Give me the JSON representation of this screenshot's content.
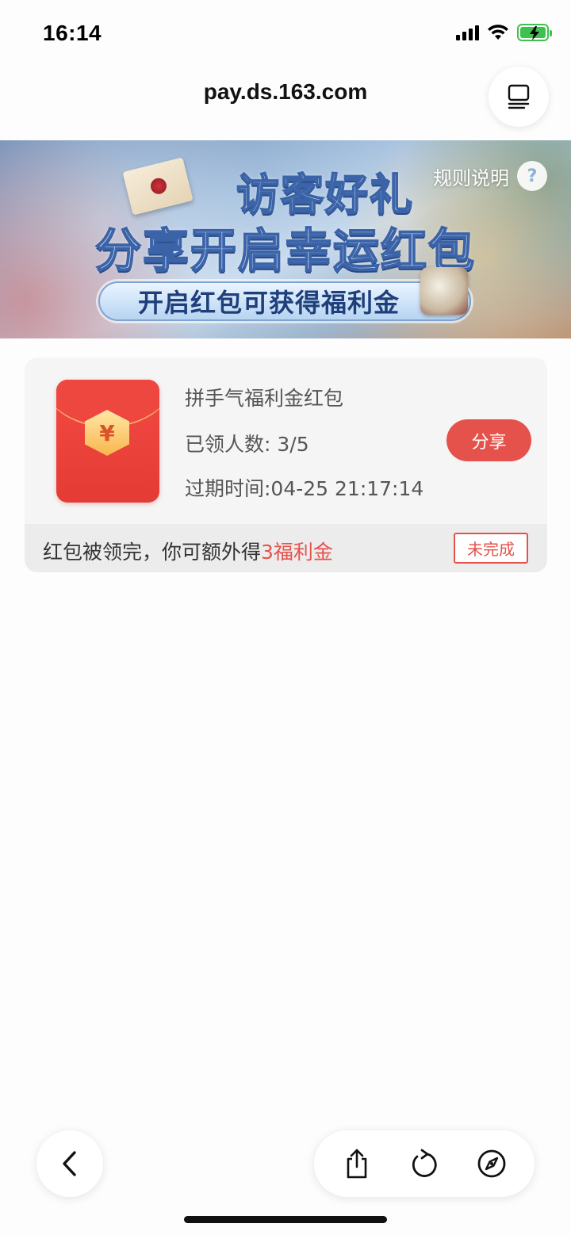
{
  "status_bar": {
    "time": "16:14",
    "icons": [
      "cellular-signal-icon",
      "wifi-icon",
      "battery-charging-icon"
    ],
    "battery_color": "#3ec24f"
  },
  "browser": {
    "url": "pay.ds.163.com",
    "tabs_icon": "tabs-icon"
  },
  "banner": {
    "title_line1": "访客好礼",
    "title_line2": "分享开启幸运红包",
    "ribbon_text": "开启红包可获得福利金",
    "rules_label": "规则说明",
    "rules_icon": "help-icon",
    "rules_icon_glyph": "?"
  },
  "red_packet": {
    "title": "拼手气福利金红包",
    "claimed": "已领人数: 3/5",
    "expire": "过期时间:04-25 21:17:14",
    "share_label": "分享",
    "currency_glyph": "¥",
    "footer_text": "红包被领完，你可额外得",
    "footer_reward": "3福利金",
    "status_label": "未完成",
    "accent_color": "#e5524c"
  },
  "bottom_bar": {
    "icons": [
      "back-icon",
      "share-icon",
      "reload-icon",
      "compass-icon"
    ]
  }
}
